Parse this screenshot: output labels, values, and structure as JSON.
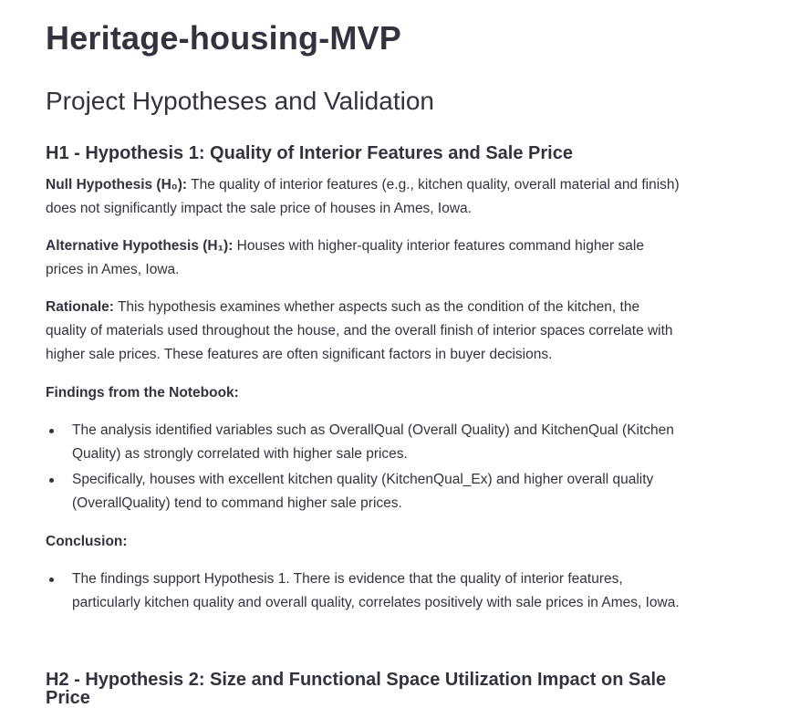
{
  "app": {
    "title": "Heritage-housing-MVP"
  },
  "section": {
    "title": "Project Hypotheses and Validation"
  },
  "h1": {
    "title": "H1 - Hypothesis 1: Quality of Interior Features and Sale Price",
    "null_label": "Null Hypothesis (H₀):",
    "null_text": " The quality of interior features (e.g., kitchen quality, overall material and finish) does not significantly impact the sale price of houses in Ames, Iowa.",
    "alt_label": "Alternative Hypothesis (H₁):",
    "alt_text": " Houses with higher-quality interior features command higher sale prices in Ames, Iowa.",
    "rationale_label": "Rationale:",
    "rationale_text": " This hypothesis examines whether aspects such as the condition of the kitchen, the quality of materials used throughout the house, and the overall finish of interior spaces correlate with higher sale prices. These features are often significant factors in buyer decisions.",
    "findings_label": "Findings from the Notebook:",
    "findings": [
      "The analysis identified variables such as OverallQual (Overall Quality) and KitchenQual (Kitchen Quality) as strongly correlated with higher sale prices.",
      "Specifically, houses with excellent kitchen quality (KitchenQual_Ex) and higher overall quality (OverallQuality) tend to command higher sale prices."
    ],
    "conclusion_label": "Conclusion:",
    "conclusions": [
      "The findings support Hypothesis 1. There is evidence that the quality of interior features, particularly kitchen quality and overall quality, correlates positively with sale prices in Ames, Iowa."
    ]
  },
  "h2": {
    "title": "H2 - Hypothesis 2: Size and Functional Space Utilization Impact on Sale Price"
  }
}
